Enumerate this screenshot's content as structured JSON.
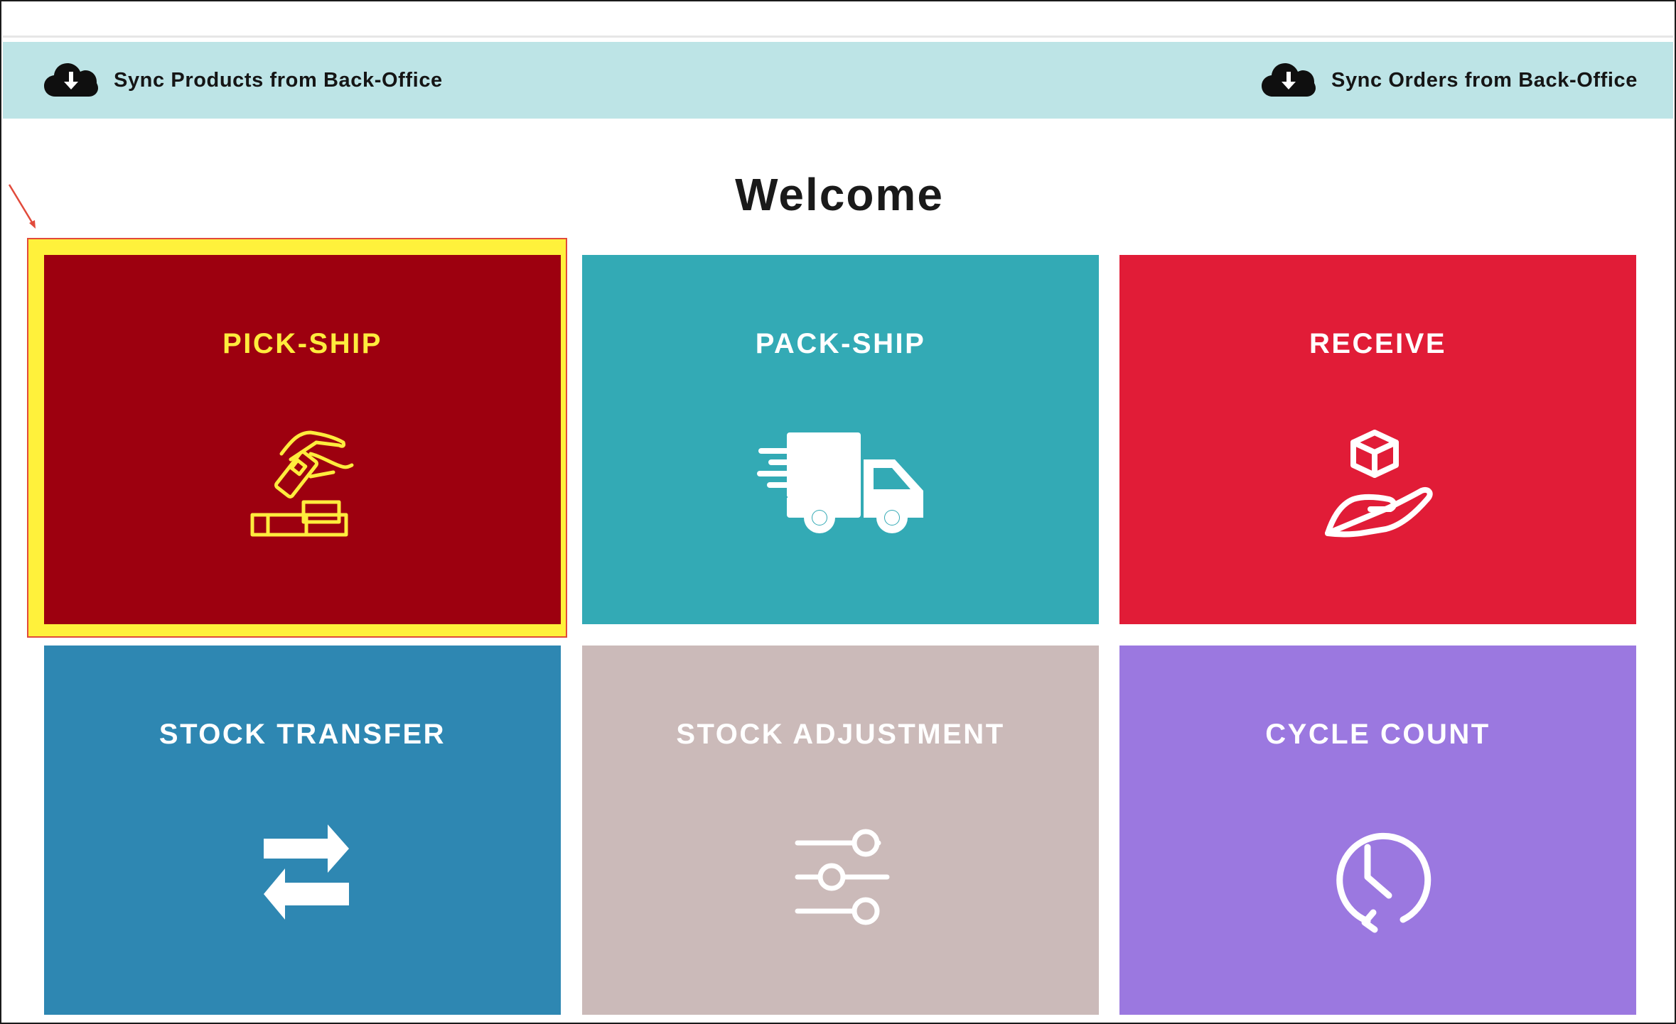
{
  "sync": {
    "products_label": "Sync Products from Back-Office",
    "orders_label": "Sync Orders from Back-Office",
    "icon": "cloud-download-icon"
  },
  "page": {
    "title": "Welcome"
  },
  "tiles": [
    {
      "label": "PICK-SHIP",
      "color": "#9d000f",
      "icon": "pick-box-icon",
      "selected": true
    },
    {
      "label": "PACK-SHIP",
      "color": "#33aab5",
      "icon": "delivery-truck-icon"
    },
    {
      "label": "RECEIVE",
      "color": "#e11c37",
      "icon": "hand-package-icon"
    },
    {
      "label": "STOCK TRANSFER",
      "color": "#2e87b2",
      "icon": "transfer-arrows-icon"
    },
    {
      "label": "STOCK ADJUSTMENT",
      "color": "#cbbab9",
      "icon": "sliders-icon"
    },
    {
      "label": "CYCLE COUNT",
      "color": "#9b78e0",
      "icon": "clock-history-icon"
    }
  ],
  "colors": {
    "sync_bar": "#bde4e6",
    "highlight": "#fff13b",
    "highlight_border": "#e14a3b",
    "selected_label": "#ffec3d"
  }
}
